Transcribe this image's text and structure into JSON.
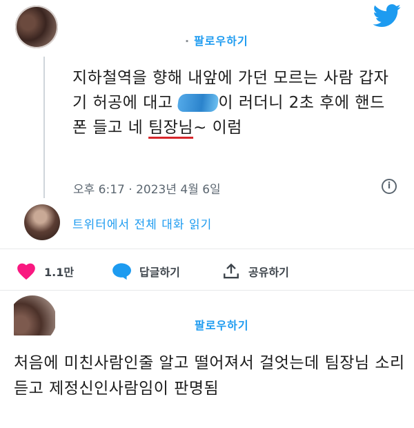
{
  "tweet": {
    "follow_label": "팔로우하기",
    "text_before_censor": "지하철역을 향해 내앞에 가던 모르는 사람 갑자기 허공에 대고 ",
    "text_after_censor": "이 러더니 2초 후에 핸드폰 들고 네 ",
    "highlight": "팀장님",
    "text_end": "~ 이럼",
    "timestamp": "오후 6:17 · 2023년 4월 6일",
    "read_thread_label": "트위터에서 전체 대화 읽기"
  },
  "actions": {
    "likes": "1.1만",
    "reply_label": "답글하기",
    "share_label": "공유하기"
  },
  "reply": {
    "follow_label": "팔로우하기",
    "text": "처음에 미친사람인줄 알고 떨어져서 걸엇는데 팀장님 소리 듣고 제정신인사람임이 판명됨"
  },
  "colors": {
    "accent": "#1d9bf0",
    "like": "#f91880",
    "underline": "#d7262b"
  }
}
